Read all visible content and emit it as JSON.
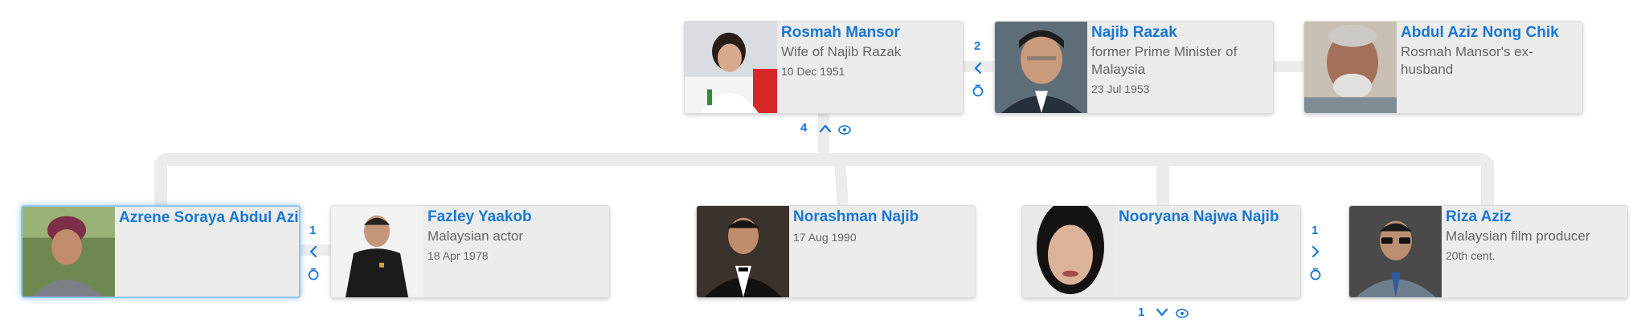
{
  "accent_color": "#1878d4",
  "people": {
    "rosmah": {
      "name": "Rosmah Mansor",
      "desc": "Wife of Najib Razak",
      "date": "10 Dec 1951"
    },
    "najib": {
      "name": "Najib Razak",
      "desc": "former Prime Minister of Malaysia",
      "date": "23 Jul 1953"
    },
    "abdul_aziz": {
      "name": "Abdul Aziz Nong Chik",
      "desc": "Rosmah Mansor's ex-husband"
    },
    "azrene": {
      "name": "Azrene Soraya Abdul Aziz"
    },
    "fazley": {
      "name": "Fazley Yaakob",
      "desc": "Malaysian actor",
      "date": "18 Apr 1978"
    },
    "norashman": {
      "name": "Norashman Najib",
      "date": "17 Aug 1990"
    },
    "nooryana": {
      "name": "Nooryana Najwa Najib"
    },
    "riza": {
      "name": "Riza Aziz",
      "desc": "Malaysian film producer",
      "date": "20th cent."
    }
  },
  "controls": {
    "spouses_count_rosmah": "2",
    "children_count_rosmah": "4",
    "spouses_count_azrene": "1",
    "spouses_count_nooryana": "1",
    "children_count_nooryana": "1"
  },
  "icons": {
    "expand_left": "chevron-left-icon",
    "expand_right": "chevron-right-icon",
    "collapse_up": "chevron-up-icon",
    "expand_down": "chevron-down-icon",
    "ring": "ring-icon",
    "view": "eye-icon"
  }
}
